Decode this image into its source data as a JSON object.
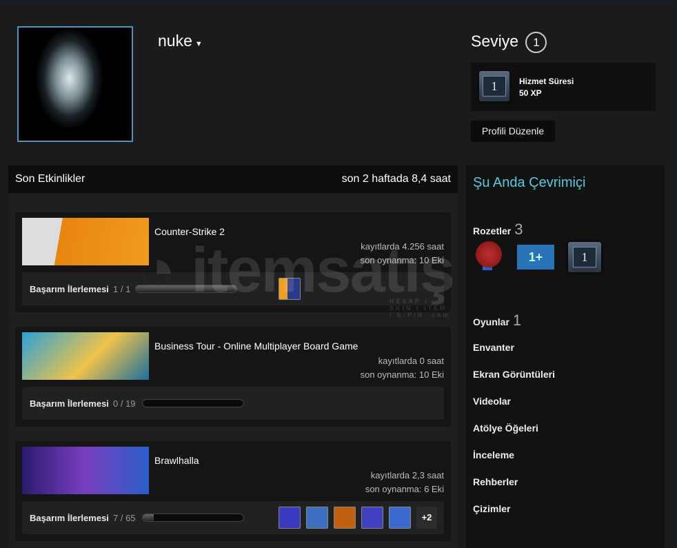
{
  "profile": {
    "name": "nuke",
    "level_label": "Seviye",
    "level": "1",
    "xp_badge_number": "1",
    "xp_title": "Hizmet Süresi",
    "xp_value": "50 XP",
    "edit_button": "Profili Düzenle"
  },
  "activity": {
    "title": "Son Etkinlikler",
    "summary": "son 2 haftada 8,4 saat",
    "achievement_label": "Başarım İlerlemesi",
    "games": [
      {
        "name": "Counter-Strike 2",
        "hours": "kayıtlarda 4.256 saat",
        "last_played": "son oynanma: 10 Eki",
        "achievements": "1 / 1",
        "progress": 1.0,
        "icons": [
          "cs-achievement-icon"
        ],
        "more": ""
      },
      {
        "name": "Business Tour - Online Multiplayer Board Game",
        "hours": "kayıtlarda 0 saat",
        "last_played": "son oynanma: 10 Eki",
        "achievements": "0 / 19",
        "progress": 0,
        "icons": [],
        "more": ""
      },
      {
        "name": "Brawlhalla",
        "hours": "kayıtlarda 2,3 saat",
        "last_played": "son oynanma: 6 Eki",
        "achievements": "7 / 65",
        "progress": 0.108,
        "icons": [
          "sword-icon",
          "no-entry-icon",
          "2x-icon",
          "star-icon",
          "splash-icon"
        ],
        "more": "+2"
      }
    ]
  },
  "sidebar": {
    "status": "Şu Anda Çevrimiçi",
    "badges_label": "Rozetler",
    "badges_count": "3",
    "badge_number": "1",
    "games_label": "Oyunlar",
    "games_count": "1",
    "links": [
      "Envanter",
      "Ekran Görüntüleri",
      "Videolar",
      "Atölye Öğeleri",
      "İnceleme",
      "Rehberler",
      "Çizimler"
    ]
  },
  "watermark": {
    "text": "itemsatış",
    "sub": "HESAP / SKIN / ITEM / E-PIN .com"
  },
  "colors": {
    "accent": "#57cbde",
    "avatar_border": "#4f94bc"
  }
}
